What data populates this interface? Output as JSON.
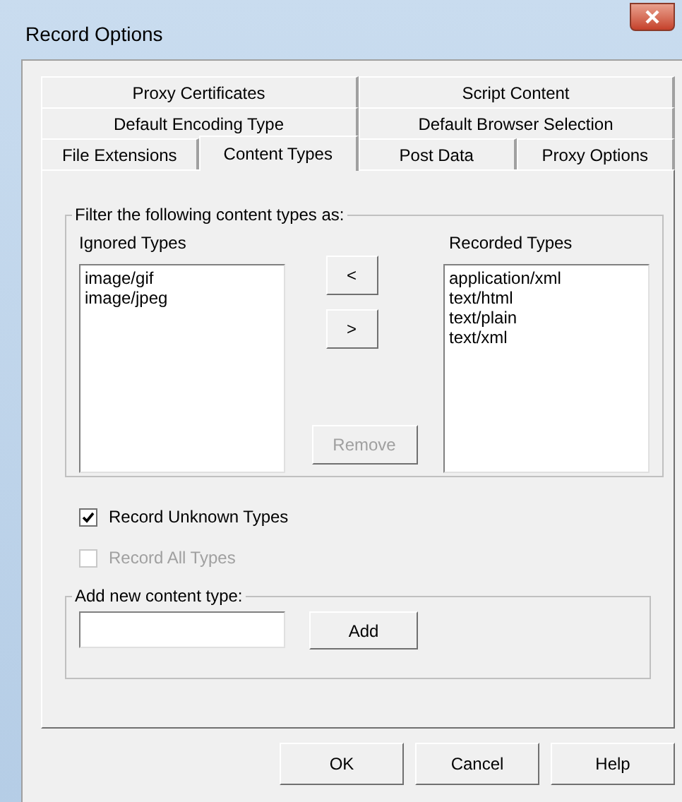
{
  "window": {
    "title": "Record Options"
  },
  "tab_rows": [
    [
      {
        "label": "Proxy Certificates",
        "selected": false
      },
      {
        "label": "Script Content",
        "selected": false
      }
    ],
    [
      {
        "label": "Default Encoding Type",
        "selected": false
      },
      {
        "label": "Default Browser Selection",
        "selected": false
      }
    ],
    [
      {
        "label": "File Extensions",
        "selected": false
      },
      {
        "label": "Content Types",
        "selected": true
      },
      {
        "label": "Post Data",
        "selected": false
      },
      {
        "label": "Proxy Options",
        "selected": false
      }
    ]
  ],
  "filter_group": {
    "title": "Filter the following content types as:",
    "ignored": {
      "label": "Ignored Types",
      "items": [
        "image/gif",
        "image/jpeg"
      ]
    },
    "move_buttons": [
      {
        "label": "<",
        "disabled": false
      },
      {
        "label": ">",
        "disabled": false
      }
    ],
    "remove_button": {
      "label": "Remove",
      "disabled": true
    },
    "recorded": {
      "label": "Recorded Types",
      "items": [
        "application/xml",
        "text/html",
        "text/plain",
        "text/xml"
      ]
    }
  },
  "checkboxes": [
    {
      "label": "Record Unknown Types",
      "checked": true,
      "disabled": false
    },
    {
      "label": "Record All Types",
      "checked": false,
      "disabled": true
    }
  ],
  "add_group": {
    "title": "Add new content type:",
    "add_button": "Add"
  },
  "buttons": [
    "OK",
    "Cancel",
    "Help"
  ]
}
